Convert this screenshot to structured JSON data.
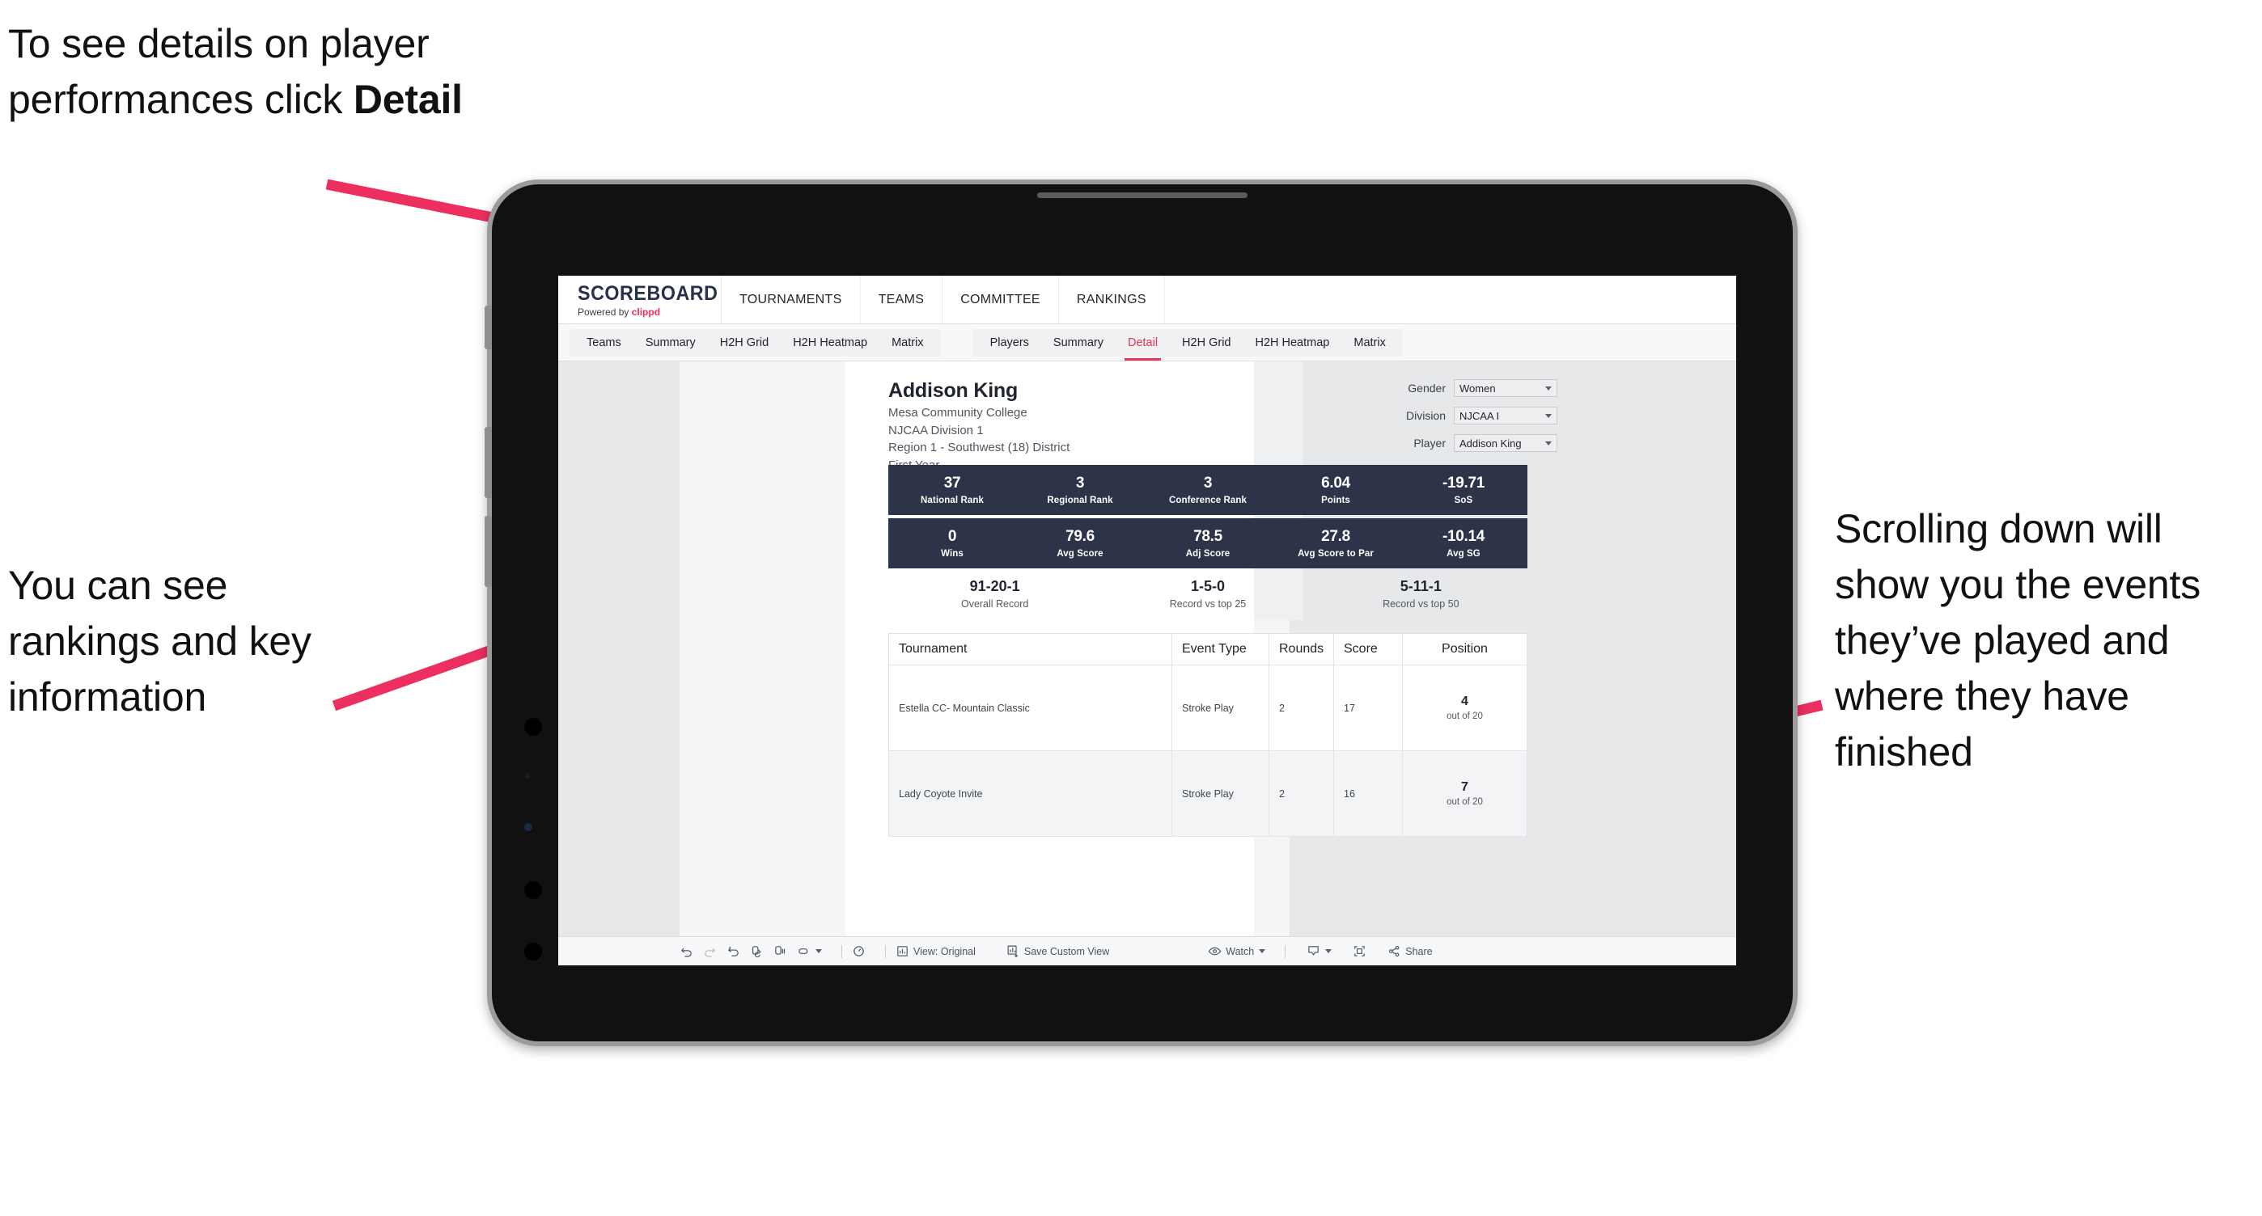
{
  "annotations": {
    "top_left": "To see details on player performances click ",
    "top_left_bold": "Detail",
    "mid_left": "You can see rankings and key information",
    "right": "Scrolling down will show you the events they’ve played and where they have finished"
  },
  "app": {
    "brand": {
      "title": "SCOREBOARD",
      "powered_prefix": "Powered by ",
      "powered_name": "clippd"
    },
    "topnav": [
      "TOURNAMENTS",
      "TEAMS",
      "COMMITTEE",
      "RANKINGS"
    ],
    "tabs_group_1": [
      "Teams",
      "Summary",
      "H2H Grid",
      "H2H Heatmap",
      "Matrix"
    ],
    "tabs_group_2": [
      "Players",
      "Summary",
      "Detail",
      "H2H Grid",
      "H2H Heatmap",
      "Matrix"
    ],
    "active_tab": "Detail"
  },
  "player": {
    "name": "Addison King",
    "school": "Mesa Community College",
    "division": "NJCAA Division 1",
    "region": "Region 1 - Southwest (18) District",
    "year": "First Year"
  },
  "selectors": [
    {
      "label": "Gender",
      "value": "Women"
    },
    {
      "label": "Division",
      "value": "NJCAA I"
    },
    {
      "label": "Player",
      "value": "Addison King"
    }
  ],
  "stats_row_1": [
    {
      "value": "37",
      "label": "National Rank"
    },
    {
      "value": "3",
      "label": "Regional Rank"
    },
    {
      "value": "3",
      "label": "Conference Rank"
    },
    {
      "value": "6.04",
      "label": "Points"
    },
    {
      "value": "-19.71",
      "label": "SoS"
    }
  ],
  "stats_row_2": [
    {
      "value": "0",
      "label": "Wins"
    },
    {
      "value": "79.6",
      "label": "Avg Score"
    },
    {
      "value": "78.5",
      "label": "Adj Score"
    },
    {
      "value": "27.8",
      "label": "Avg Score to Par"
    },
    {
      "value": "-10.14",
      "label": "Avg SG"
    }
  ],
  "records": [
    {
      "value": "91-20-1",
      "label": "Overall Record"
    },
    {
      "value": "1-5-0",
      "label": "Record vs top 25"
    },
    {
      "value": "5-11-1",
      "label": "Record vs top 50"
    }
  ],
  "table": {
    "headers": [
      "Tournament",
      "Event Type",
      "Rounds",
      "Score",
      "Position"
    ],
    "rows": [
      {
        "tournament": "Estella CC- Mountain Classic",
        "event_type": "Stroke Play",
        "rounds": "2",
        "score": "17",
        "position": "4",
        "position_sub": "out of 20"
      },
      {
        "tournament": "Lady Coyote Invite",
        "event_type": "Stroke Play",
        "rounds": "2",
        "score": "16",
        "position": "7",
        "position_sub": "out of 20"
      }
    ]
  },
  "toolbar": {
    "view_label": "View: Original",
    "save_label": "Save Custom View",
    "watch_label": "Watch",
    "share_label": "Share"
  },
  "colors": {
    "accent_pink": "#e8345a",
    "navy": "#2d3449",
    "arrow": "#ec2f5f"
  }
}
